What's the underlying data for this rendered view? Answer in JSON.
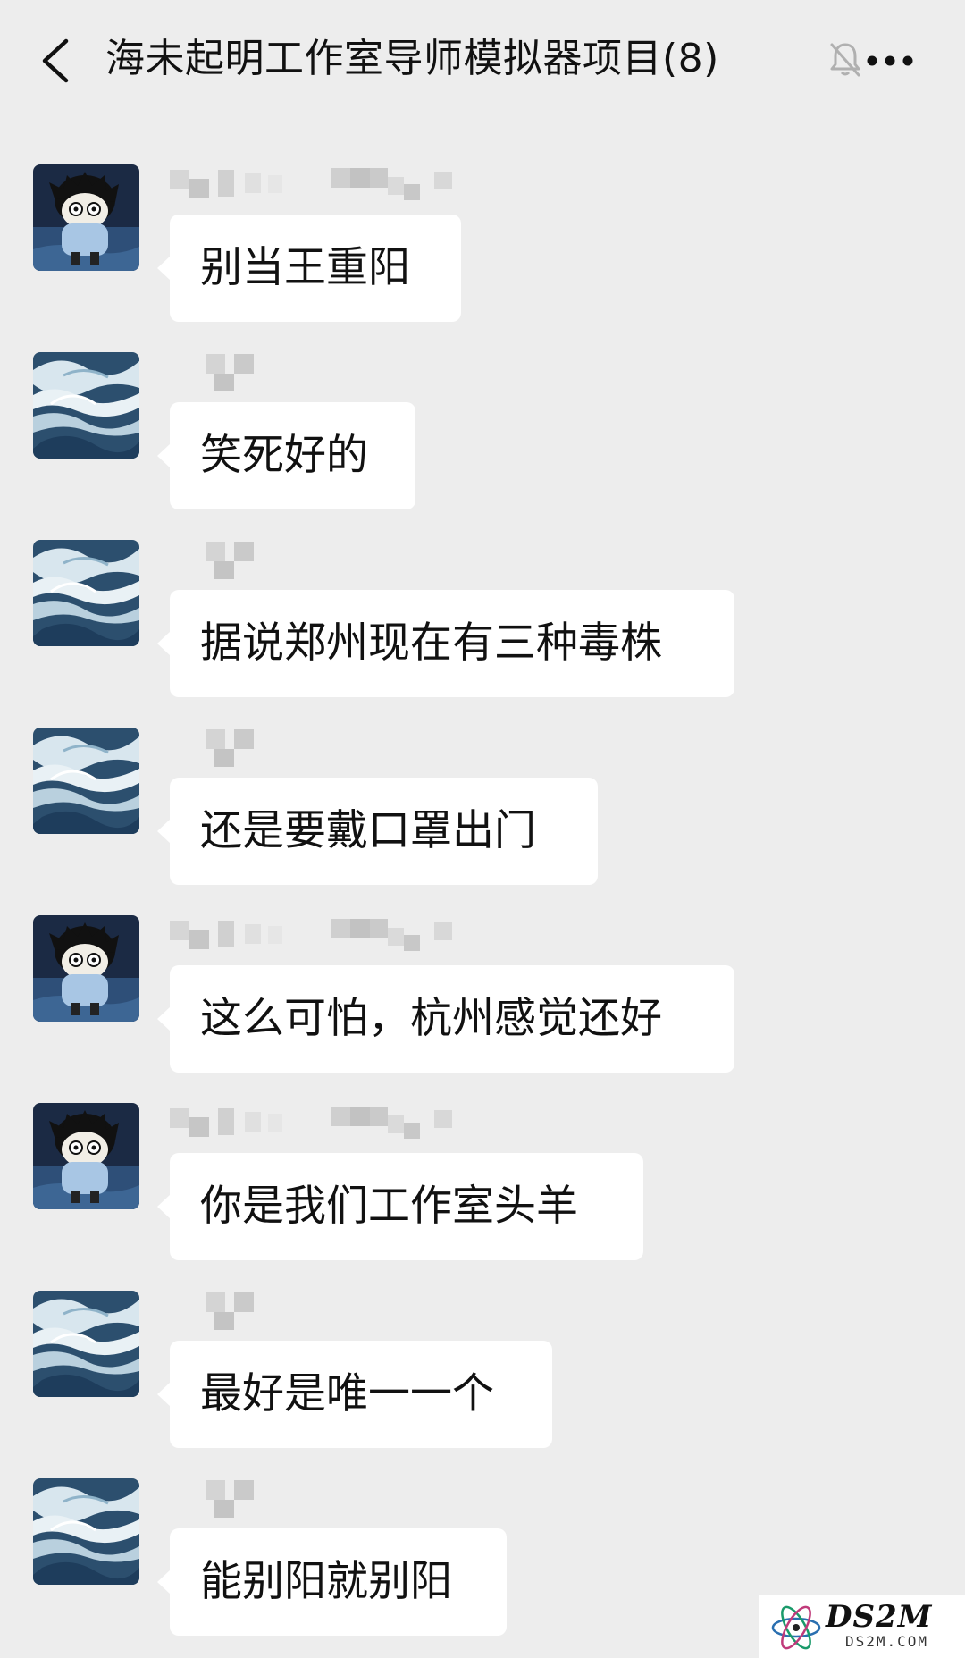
{
  "header": {
    "title": "海未起明工作室导师模拟器项目(8)",
    "back_icon": "chevron-left-icon",
    "mute_icon": "bell-off-icon",
    "more_icon": "more-dots-icon"
  },
  "messages": [
    {
      "avatar": "cartoon-boy",
      "text": "别当王重阳"
    },
    {
      "avatar": "wave",
      "text": "笑死好的"
    },
    {
      "avatar": "wave",
      "text": "据说郑州现在有三种毒株"
    },
    {
      "avatar": "wave",
      "text": "还是要戴口罩出门"
    },
    {
      "avatar": "cartoon-boy",
      "text": "这么可怕，杭州感觉还好"
    },
    {
      "avatar": "cartoon-boy",
      "text": "你是我们工作室头羊"
    },
    {
      "avatar": "wave",
      "text": "最好是唯一一个"
    },
    {
      "avatar": "wave",
      "text": "能别阳就别阳"
    }
  ],
  "watermark": {
    "brand": "DS2M",
    "url": "DS2M.COM"
  },
  "colors": {
    "background": "#ededed",
    "bubble": "#ffffff",
    "text": "#111111"
  }
}
